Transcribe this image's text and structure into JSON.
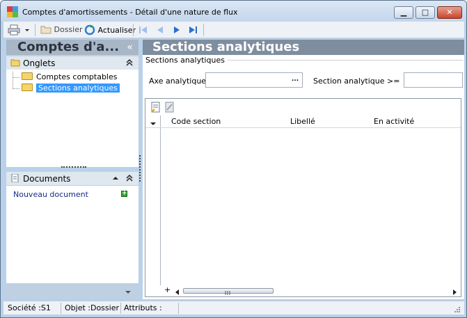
{
  "window": {
    "title": "Comptes d'amortissements -  Détail d'une nature de flux",
    "buttons": {
      "minimize": "▁",
      "maximize": "□",
      "close": "✕"
    }
  },
  "toolbar": {
    "print_icon": "printer-icon",
    "dossier_label": "Dossier",
    "refresh_label": "Actualiser"
  },
  "left_panel": {
    "title": "Comptes d'a...",
    "collapse_glyph": "«",
    "onglets": {
      "label": "Onglets",
      "items": [
        {
          "label": "Comptes comptables",
          "selected": false
        },
        {
          "label": "Sections analytiques",
          "selected": true
        }
      ]
    },
    "documents": {
      "label": "Documents",
      "new_document": "Nouveau document"
    }
  },
  "main": {
    "title": "Sections analytiques",
    "group_label": "Sections analytiques",
    "axe_label": "Axe analytique",
    "axe_value": "",
    "section_label": "Section analytique >=",
    "section_value": "",
    "ellipsis": "...",
    "grid": {
      "columns": [
        "Code section",
        "Libellé",
        "En activité"
      ],
      "rows": [],
      "add_glyph": "+"
    }
  },
  "statusbar": {
    "societe": "Société :S1",
    "objet": "Objet :Dossier",
    "attributs": "Attributs :"
  }
}
